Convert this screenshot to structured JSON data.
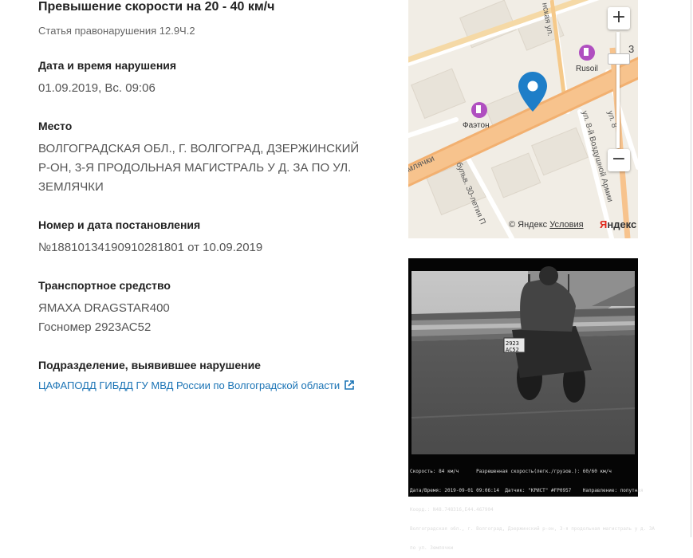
{
  "violation": {
    "title": "Превышение скорости на 20 - 40 км/ч",
    "article": "Статья правонарушения 12.9Ч.2"
  },
  "datetime": {
    "label": "Дата и время нарушения",
    "value": "01.09.2019, Вс. 09:06"
  },
  "place": {
    "label": "Место",
    "lines": [
      "ВОЛГОГРАДСКАЯ ОБЛ., Г. ВОЛГОГРАД, ДЗЕРЖИНСКИЙ",
      "Р-ОН, 3-Я ПРОДОЛЬНАЯ МАГИСТРАЛЬ У Д. ЗА ПО УЛ.",
      "ЗЕМЛЯЧКИ"
    ]
  },
  "decree": {
    "label": "Номер и дата постановления",
    "value": "№18810134190910281801 от 10.09.2019"
  },
  "vehicle": {
    "label": "Транспортное средство",
    "model": "ЯМАХА DRAGSTAR400",
    "plate": "Госномер 2923АС52"
  },
  "department": {
    "label": "Подразделение, выявившее нарушение",
    "link": "ЦАФАПОДД ГИБДД ГУ МВД России по Волгоградской области"
  },
  "map": {
    "zoom_in": "+",
    "zoom_out": "−",
    "copyright": "© Яндекс",
    "terms": "Условия",
    "logo_red": "Я",
    "logo_rest": "ндекс",
    "labels": {
      "rusoil": "Rusoil",
      "faeton": "Фаэтон",
      "zemlyachki": "млячки",
      "street_top": "нская ул.",
      "boulevard": "бульв. 30-летия П",
      "vozdushnoy": "ул. 8-й Воздушной Армии",
      "ul_8": "ул. 8",
      "number": "3"
    },
    "colors": {
      "road": "#f5c98a",
      "road_main": "#f7b56b",
      "marker": "#1e7ec8",
      "fuel": "#b04fc0"
    }
  },
  "photo": {
    "plate_line1": "2923",
    "plate_line2": "АС52",
    "caption": [
      "Скорость: 84 км/ч      Разрешенная скорость(легк./грузов.): 60/60 км/ч",
      "Дата/Время: 2019-09-01 09:06:14  Датчик: \"КРИСТ\" #FP0957    Направление: попутная",
      "Коорд.: N48.748316,E44.467904",
      "Волгоградская обл., г. Волгоград, Дзержинский р-он, 3-я продольная магистраль у д. 3А",
      "по ул. Землячки"
    ]
  }
}
